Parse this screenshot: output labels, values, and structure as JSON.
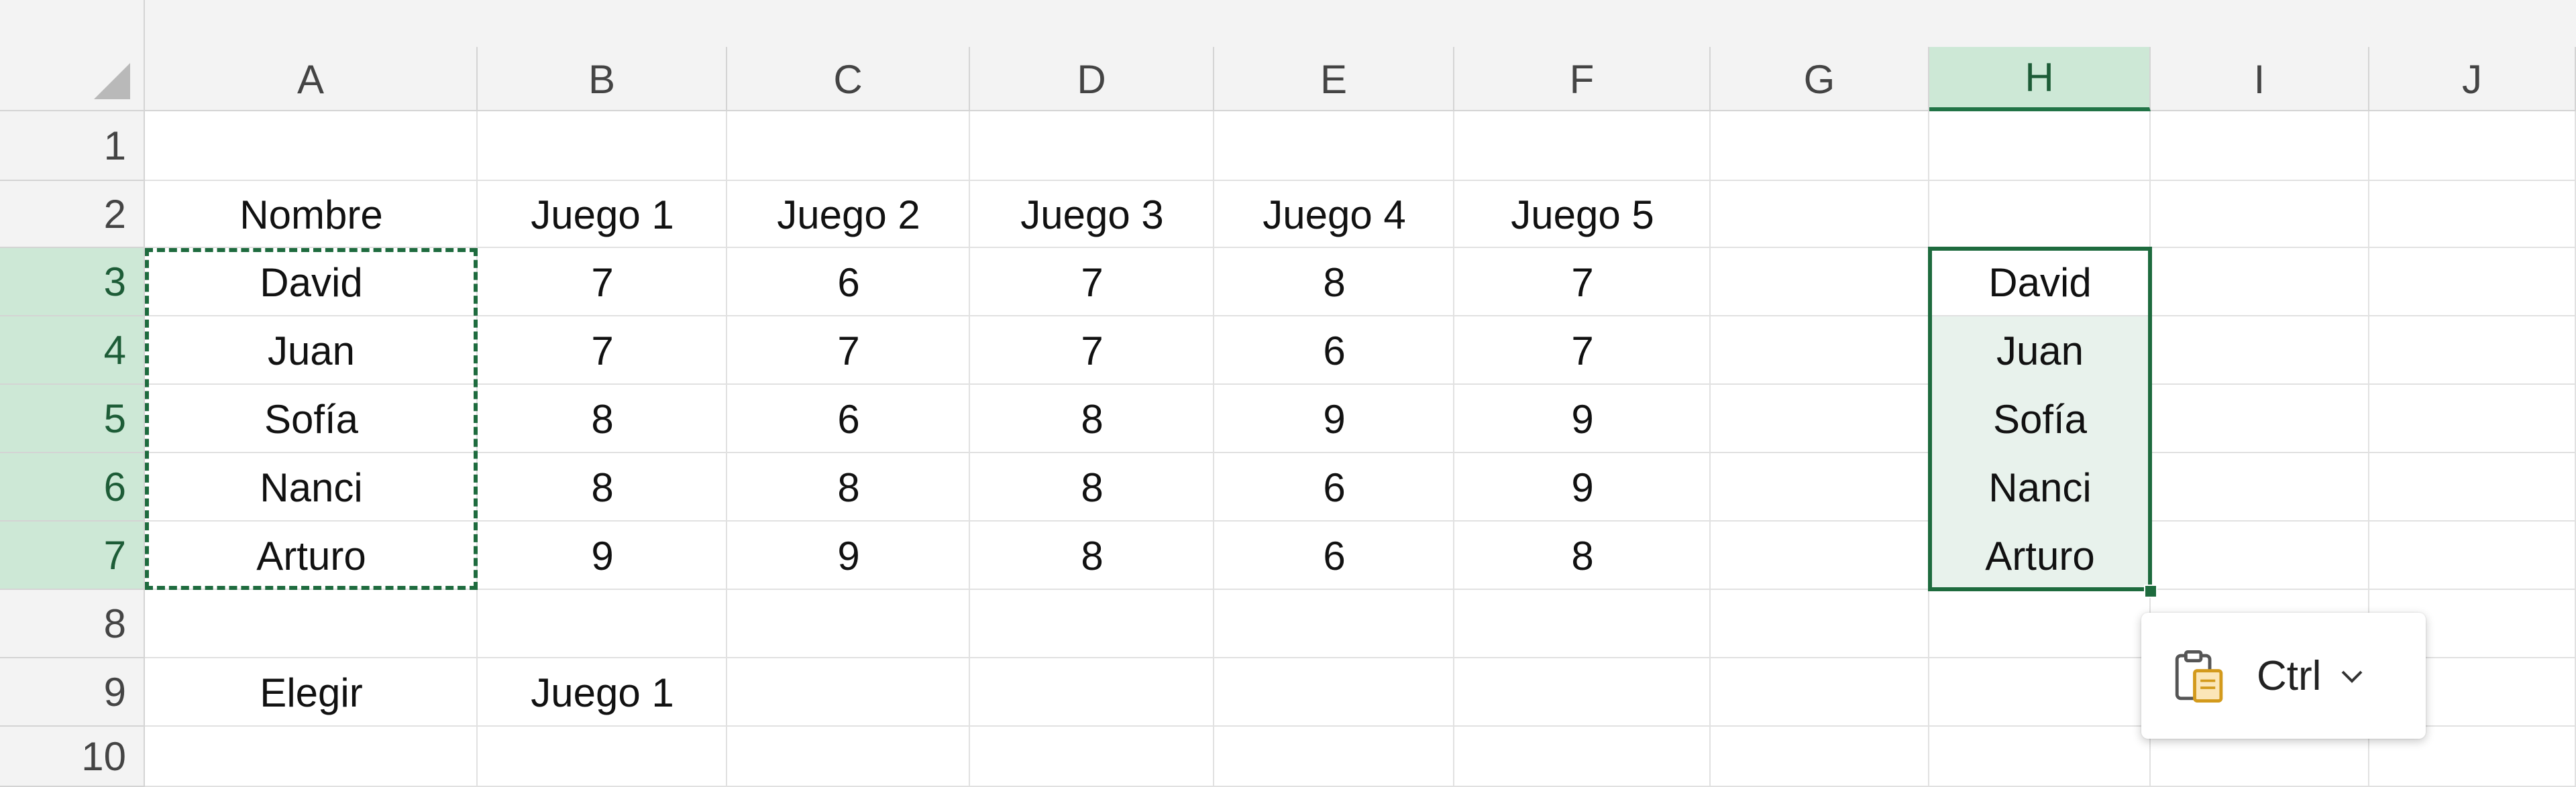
{
  "columns": [
    "A",
    "B",
    "C",
    "D",
    "E",
    "F",
    "G",
    "H",
    "I",
    "J"
  ],
  "active_column": "H",
  "rows": [
    "1",
    "2",
    "3",
    "4",
    "5",
    "6",
    "7",
    "8",
    "9",
    "10"
  ],
  "active_rows": [
    "3",
    "4",
    "5",
    "6",
    "7"
  ],
  "cells": {
    "A2": "Nombre",
    "B2": "Juego 1",
    "C2": "Juego 2",
    "D2": "Juego 3",
    "E2": "Juego 4",
    "F2": "Juego 5",
    "A3": "David",
    "B3": "7",
    "C3": "6",
    "D3": "7",
    "E3": "8",
    "F3": "7",
    "A4": "Juan",
    "B4": "7",
    "C4": "7",
    "D4": "7",
    "E4": "6",
    "F4": "7",
    "A5": "Sofía",
    "B5": "8",
    "C5": "6",
    "D5": "8",
    "E5": "9",
    "F5": "9",
    "A6": "Nanci",
    "B6": "8",
    "C6": "8",
    "D6": "8",
    "E6": "6",
    "F6": "9",
    "A7": "Arturo",
    "B7": "9",
    "C7": "9",
    "D7": "8",
    "E7": "6",
    "F7": "8",
    "A9": "Elegir",
    "B9": "Juego 1",
    "H3": "David",
    "H4": "Juan",
    "H5": "Sofía",
    "H6": "Nanci",
    "H7": "Arturo"
  },
  "copy_range": "A3:A7",
  "selected_range": "H3:H7",
  "paste_options": {
    "label": "Ctrl",
    "icon": "clipboard-icon",
    "dropdown_icon": "chevron-down-icon"
  },
  "colors": {
    "accent": "#217346",
    "selection_fill": "#e8f2ec",
    "header_active": "#cde8d6"
  }
}
